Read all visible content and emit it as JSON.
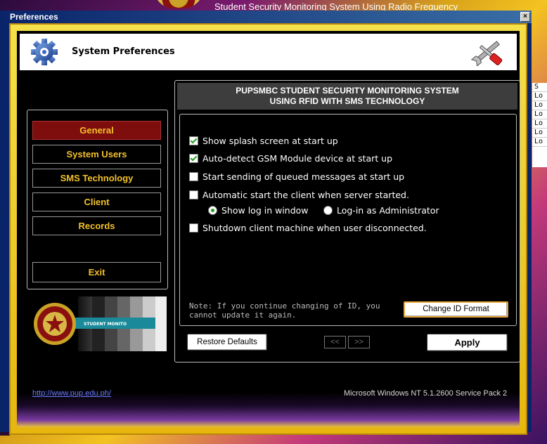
{
  "background": {
    "app_title": "Student Security Monitoring System Using Radio Frequency",
    "right_column_items": [
      "S",
      "Lo",
      "Lo",
      "Lo",
      "Lo",
      "Lo",
      "Lo"
    ]
  },
  "window": {
    "title": "Preferences",
    "close_label": "×"
  },
  "header": {
    "title": "System Preferences",
    "left_icon": "gear-icon",
    "right_icon": "tools-icon"
  },
  "nav": {
    "items": [
      {
        "label": "General",
        "active": true
      },
      {
        "label": "System Users",
        "active": false
      },
      {
        "label": "SMS Technology",
        "active": false
      },
      {
        "label": "Client",
        "active": false
      },
      {
        "label": "Records",
        "active": false
      }
    ],
    "exit_label": "Exit",
    "active_color": "#7e0d0d",
    "text_color": "#f3c12a"
  },
  "logo": {
    "banner_text": "STUDENT MONITO"
  },
  "main": {
    "heading_line1": "PUPSMBC STUDENT SECURITY MONITORING SYSTEM",
    "heading_line2": "USING RFID WITH SMS TECHNOLOGY",
    "options": [
      {
        "label": "Show splash screen at start up",
        "checked": true
      },
      {
        "label": "Auto-detect GSM Module device at start up",
        "checked": true
      },
      {
        "label": "Start sending of queued messages at start up",
        "checked": false
      },
      {
        "label": "Automatic start the client when server started.",
        "checked": false
      },
      {
        "label": "Shutdown client machine when user disconnected.",
        "checked": false
      }
    ],
    "radios": [
      {
        "label": "Show log in window",
        "checked": true
      },
      {
        "label": "Log-in as Administrator",
        "checked": false
      }
    ],
    "note": "Note: If you continue changing of ID, you cannot update it again.",
    "change_id_label": "Change ID Format",
    "restore_label": "Restore Defaults",
    "prev_label": "<<",
    "next_label": ">>",
    "apply_label": "Apply"
  },
  "footer": {
    "link": "http://www.pup.edu.ph/",
    "os_info": "Microsoft Windows NT 5.1.2600 Service Pack 2"
  }
}
